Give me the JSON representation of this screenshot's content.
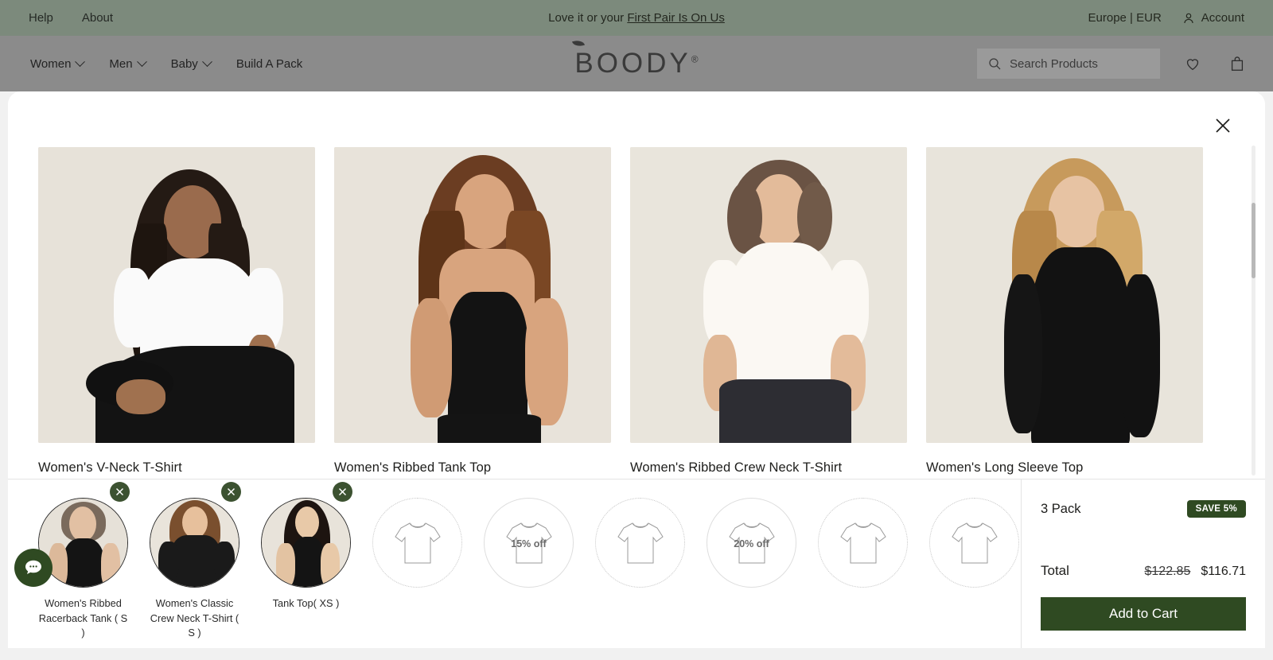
{
  "header": {
    "announce": {
      "links": [
        {
          "label": "Help"
        },
        {
          "label": "About"
        }
      ],
      "promo_prefix": "Love it or your ",
      "promo_link": "First Pair Is On Us",
      "region": "Europe | EUR",
      "account": "Account"
    },
    "nav": {
      "items": [
        {
          "label": "Women",
          "has_chevron": true
        },
        {
          "label": "Men",
          "has_chevron": true
        },
        {
          "label": "Baby",
          "has_chevron": true
        },
        {
          "label": "Build A Pack",
          "has_chevron": false
        }
      ],
      "logo": "BOODY",
      "logo_mark": "®",
      "search_placeholder": "Search Products",
      "wishlist_icon": "heart-icon",
      "cart_icon": "bag-icon"
    }
  },
  "modal": {
    "close_icon": "close-icon",
    "products": [
      {
        "name": "Women's V-Neck T-Shirt",
        "id": "vneck"
      },
      {
        "name": "Women's Ribbed Tank Top",
        "id": "ribbedtank"
      },
      {
        "name": "Women's Ribbed Crew Neck T-Shirt",
        "id": "ribbedcrew"
      },
      {
        "name": "Women's Long Sleeve Top",
        "id": "longsleeve"
      }
    ]
  },
  "builder": {
    "slots": [
      {
        "filled": true,
        "label": "Women's Ribbed Racerback Tank ( S )",
        "remove_icon": "close-icon",
        "style": "racerback"
      },
      {
        "filled": true,
        "label": "Women's Classic Crew Neck T-Shirt ( S )",
        "remove_icon": "close-icon",
        "style": "crewtee"
      },
      {
        "filled": true,
        "label": "Tank Top( XS )",
        "remove_icon": "close-icon",
        "style": "tank"
      },
      {
        "filled": false,
        "discount": "",
        "border": "dotted"
      },
      {
        "filled": false,
        "discount": "15% off",
        "border": "solid"
      },
      {
        "filled": false,
        "discount": "",
        "border": "dotted"
      },
      {
        "filled": false,
        "discount": "20% off",
        "border": "solid"
      },
      {
        "filled": false,
        "discount": "",
        "border": "dotted"
      },
      {
        "filled": false,
        "discount": "",
        "border": "dotted"
      }
    ],
    "panel": {
      "pack_label": "3 Pack",
      "save_badge": "SAVE 5%",
      "total_label": "Total",
      "price_original": "$122.85",
      "price_discounted": "$116.71",
      "add_to_cart": "Add to Cart"
    }
  },
  "chat": {
    "icon": "chat-bubble-icon"
  },
  "colors": {
    "brand_green": "#2f4a22",
    "announce_bg": "#7c8a7c",
    "nav_bg": "#8b8b8b",
    "badge_green": "#2f4a22",
    "remove_badge_green": "#3c5231"
  }
}
